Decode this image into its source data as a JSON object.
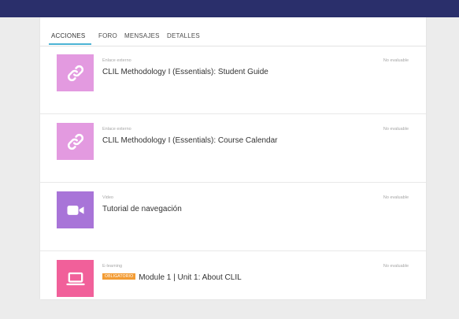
{
  "tabs": [
    {
      "label": "ACCIONES",
      "active": true
    },
    {
      "label": "FORO"
    },
    {
      "label": "MENSAJES"
    },
    {
      "label": "DETALLES"
    }
  ],
  "items": [
    {
      "type": "Enlace externo",
      "title": "CLIL Methodology I (Essentials): Student Guide",
      "status": "No evaluable",
      "icon": "link-icon",
      "color": "#e39ae0"
    },
    {
      "type": "Enlace externo",
      "title": "CLIL Methodology I (Essentials): Course Calendar",
      "status": "No evaluable",
      "icon": "link-icon",
      "color": "#e39ae0"
    },
    {
      "type": "Video",
      "title": "Tutorial de navegación",
      "status": "No evaluable",
      "icon": "video-camera-icon",
      "color": "#a874d8"
    },
    {
      "type": "E-learning",
      "badge": "OBLIGATORIO",
      "title": "Module 1 | Unit 1: About CLIL",
      "status": "No evaluable",
      "icon": "laptop-icon",
      "color": "#f1609a"
    }
  ],
  "colors": {
    "header": "#2a2f6b",
    "tab_underline": "#4bb3d4",
    "badge": "#f39c34"
  }
}
